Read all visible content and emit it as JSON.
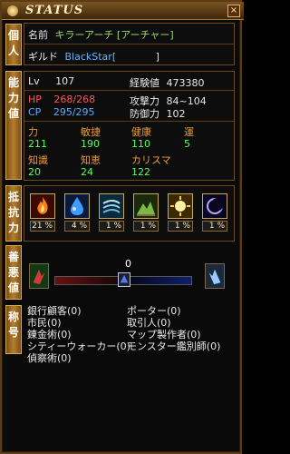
{
  "header": {
    "title": "STATUS",
    "close_label": "×"
  },
  "tabs": {
    "personal": "個人",
    "ability": "能力値",
    "resist": "抵抗力",
    "alignment": "善悪値",
    "titles": "称号"
  },
  "identity": {
    "name_key": "名前",
    "name_value": "キラーアーチ [アーチャー]",
    "guild_key": "ギルド",
    "guild_value": "BlackStar[",
    "guild_close": "]"
  },
  "stats": {
    "lv_label": "Lv",
    "lv": "107",
    "exp_label": "経験値",
    "exp": "473380",
    "hp_label": "HP",
    "hp": "268/268",
    "cp_label": "CP",
    "cp": "295/295",
    "atk_label": "攻撃力",
    "atk": "84~104",
    "def_label": "防御力",
    "def": "102"
  },
  "attributes": {
    "headers1": [
      "力",
      "敏捷",
      "健康",
      "運"
    ],
    "values1": [
      "211",
      "190",
      "110",
      "5"
    ],
    "headers2": [
      "知識",
      "知恵",
      "カリスマ"
    ],
    "values2": [
      "20",
      "24",
      "122"
    ]
  },
  "resistances": [
    {
      "name": "fire-resist-icon",
      "pct": "21 %",
      "color": "#d84a10"
    },
    {
      "name": "water-resist-icon",
      "pct": "4 %",
      "color": "#2f7bd8"
    },
    {
      "name": "wind-resist-icon",
      "pct": "1 %",
      "color": "#4aa0c8"
    },
    {
      "name": "earth-resist-icon",
      "pct": "1 %",
      "color": "#6ea844"
    },
    {
      "name": "light-resist-icon",
      "pct": "1 %",
      "color": "#e0c020"
    },
    {
      "name": "dark-resist-icon",
      "pct": "1 %",
      "color": "#2a1a6a"
    }
  ],
  "alignment": {
    "value": "0",
    "fraction": 0.5
  },
  "titles": {
    "left": [
      "銀行顧客(0)",
      "市民(0)",
      "錬金術(0)",
      "シティーウォーカー(0)",
      "偵察術(0)"
    ],
    "right": [
      "ポーター(0)",
      "取引人(0)",
      "マップ製作者(0)",
      "モンスター鑑別師(0)"
    ]
  }
}
